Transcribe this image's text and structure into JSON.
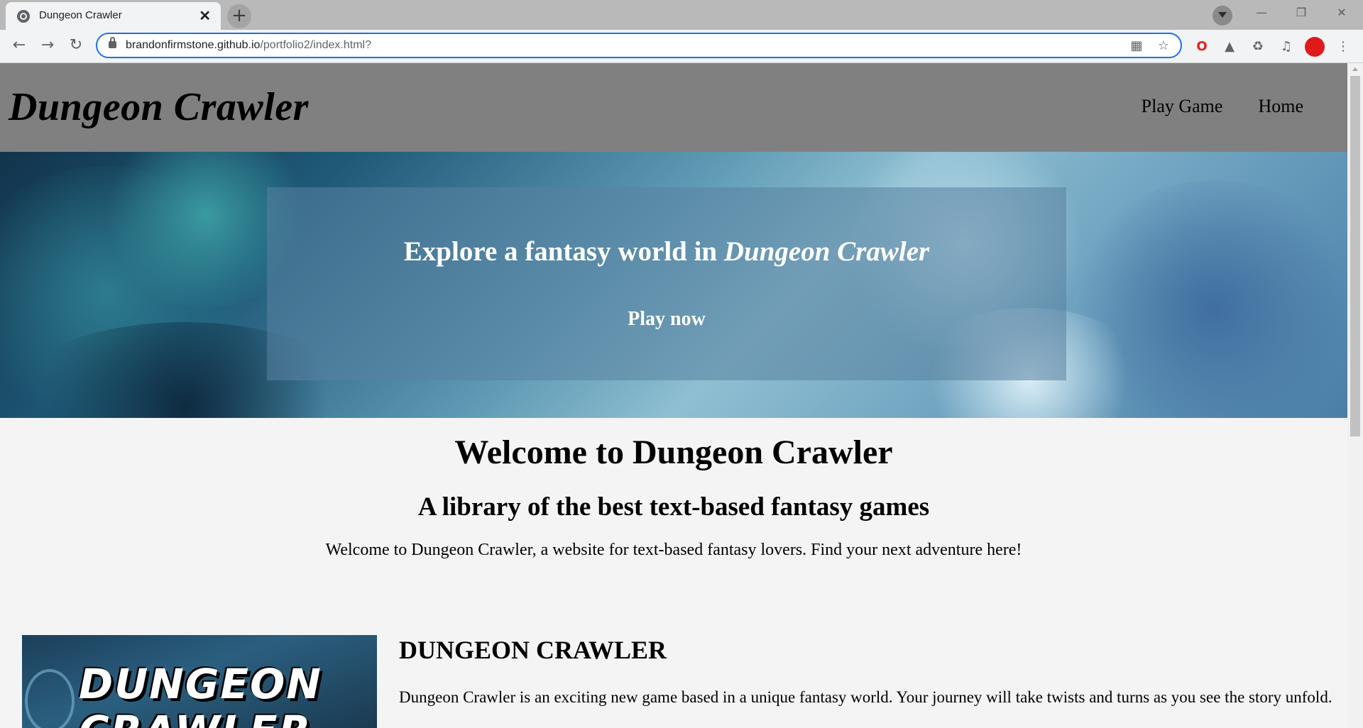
{
  "browser": {
    "tab_title": "Dungeon Crawler",
    "close_glyph": "✕",
    "new_tab_glyph": "+",
    "url_host": "brandonfirmstone.github.io",
    "url_path": "/portfolio2/index.html?",
    "icons": [
      "back-icon",
      "forward-icon",
      "reload-icon",
      "lock-icon",
      "qr-code-icon",
      "star-icon",
      "opera-icon",
      "hat-icon",
      "puzzle-icon",
      "media-icon",
      "profile-avatar",
      "menu-icon"
    ]
  },
  "site": {
    "logo": "Dungeon Crawler",
    "nav": [
      {
        "label": "Play Game"
      },
      {
        "label": "Home"
      }
    ]
  },
  "hero": {
    "heading_prefix": "Explore a fantasy world in ",
    "heading_italic": "Dungeon Crawler",
    "cta": "Play now"
  },
  "welcome": {
    "title": "Welcome to Dungeon Crawler",
    "subtitle": "A library of the best text-based fantasy games",
    "body": "Welcome to Dungeon Crawler, a website for text-based fantasy lovers. Find your next adventure here!"
  },
  "game": {
    "art_text": "DUNGEON CRAWLER",
    "title": "DUNGEON CRAWLER",
    "description": "Dungeon Crawler is an exciting new game based in a unique fantasy world. Your journey will take twists and turns as you see the story unfold."
  },
  "colors": {
    "header_bg": "#808080",
    "page_bg": "#f4f4f4",
    "omnibox_focus": "#1a73e8",
    "avatar": "#e01a1a"
  }
}
